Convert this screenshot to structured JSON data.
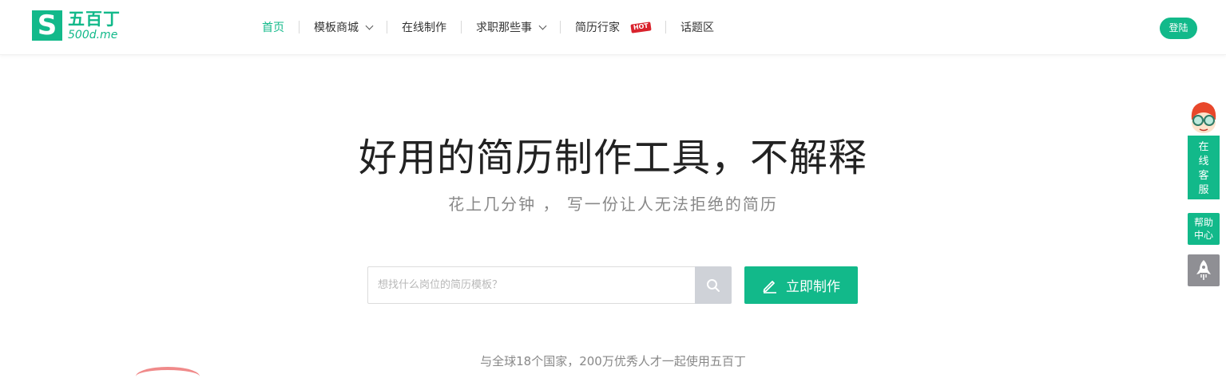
{
  "brand": {
    "logo_mark": "S",
    "name_cn": "五百丁",
    "name_en": "500d.me",
    "accent_color": "#12b98a"
  },
  "nav": {
    "items": [
      {
        "label": "首页",
        "active": true
      },
      {
        "label": "模板商城",
        "dropdown": true
      },
      {
        "label": "在线制作"
      },
      {
        "label": "求职那些事",
        "dropdown": true
      },
      {
        "label": "简历行家",
        "badge": "HOT"
      },
      {
        "label": "话题区"
      }
    ],
    "login_label": "登陆"
  },
  "hero": {
    "title": "好用的简历制作工具，不解释",
    "subtitle": "花上几分钟 ， 写一份让人无法拒绝的简历"
  },
  "search": {
    "placeholder": "想找什么岗位的简历模板？",
    "value": ""
  },
  "make_button": {
    "label": "立即制作"
  },
  "stats_line": "与全球18个国家，200万优秀人才一起使用五百丁",
  "side_tools": {
    "customer_service": [
      "在",
      "线",
      "客",
      "服"
    ],
    "help_center": [
      "帮助",
      "中心"
    ]
  }
}
